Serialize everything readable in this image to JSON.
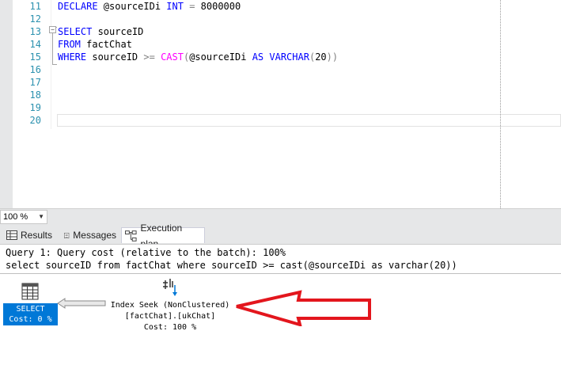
{
  "editor": {
    "lines": [
      {
        "n": "11",
        "tokens": [
          {
            "t": "DECLARE",
            "c": "kw"
          },
          {
            "t": " @sourceIDi ",
            "c": ""
          },
          {
            "t": "INT",
            "c": "kw"
          },
          {
            "t": " = ",
            "c": "op"
          },
          {
            "t": "8000000",
            "c": ""
          }
        ]
      },
      {
        "n": "12",
        "tokens": []
      },
      {
        "n": "13",
        "tokens": [
          {
            "t": "SELECT",
            "c": "kw"
          },
          {
            "t": " sourceID",
            "c": ""
          }
        ]
      },
      {
        "n": "14",
        "tokens": [
          {
            "t": "FROM",
            "c": "kw"
          },
          {
            "t": " factChat",
            "c": ""
          }
        ]
      },
      {
        "n": "15",
        "tokens": [
          {
            "t": "WHERE",
            "c": "kw"
          },
          {
            "t": " sourceID ",
            "c": ""
          },
          {
            "t": ">=",
            "c": "op"
          },
          {
            "t": " ",
            "c": ""
          },
          {
            "t": "CAST",
            "c": "fn"
          },
          {
            "t": "(",
            "c": "op"
          },
          {
            "t": "@sourceIDi ",
            "c": ""
          },
          {
            "t": "AS",
            "c": "kw"
          },
          {
            "t": " ",
            "c": ""
          },
          {
            "t": "VARCHAR",
            "c": "kw"
          },
          {
            "t": "(",
            "c": "op"
          },
          {
            "t": "20",
            "c": ""
          },
          {
            "t": "))",
            "c": "op"
          }
        ]
      },
      {
        "n": "16",
        "tokens": []
      },
      {
        "n": "17",
        "tokens": []
      },
      {
        "n": "18",
        "tokens": []
      },
      {
        "n": "19",
        "tokens": []
      },
      {
        "n": "20",
        "tokens": []
      }
    ]
  },
  "zoom": {
    "value": "100 %"
  },
  "tabs": [
    {
      "label": "Results",
      "icon": "grid-icon"
    },
    {
      "label": "Messages",
      "icon": "messages-icon"
    },
    {
      "label": "Execution plan",
      "icon": "execution-plan-icon",
      "active": true
    }
  ],
  "plan": {
    "query_header": "Query 1: Query cost (relative to the batch): 100%",
    "query_text": "select sourceID from factChat where sourceID >= cast(@sourceIDi as varchar(20))",
    "select_node": {
      "label": "SELECT",
      "cost": "Cost: 0 %",
      "icon": "select-result-icon"
    },
    "seek_node": {
      "label": "Index Seek (NonClustered)",
      "object": "[factChat].[ukChat]",
      "cost": "Cost: 100 %",
      "icon": "index-seek-icon"
    },
    "annotation": {
      "icon": "red-arrow-annotation",
      "color": "#e3161d"
    }
  },
  "colors": {
    "keyword": "#0000ff",
    "function": "#ff00ff",
    "line_number": "#2b91af",
    "selection": "#0078d7"
  }
}
